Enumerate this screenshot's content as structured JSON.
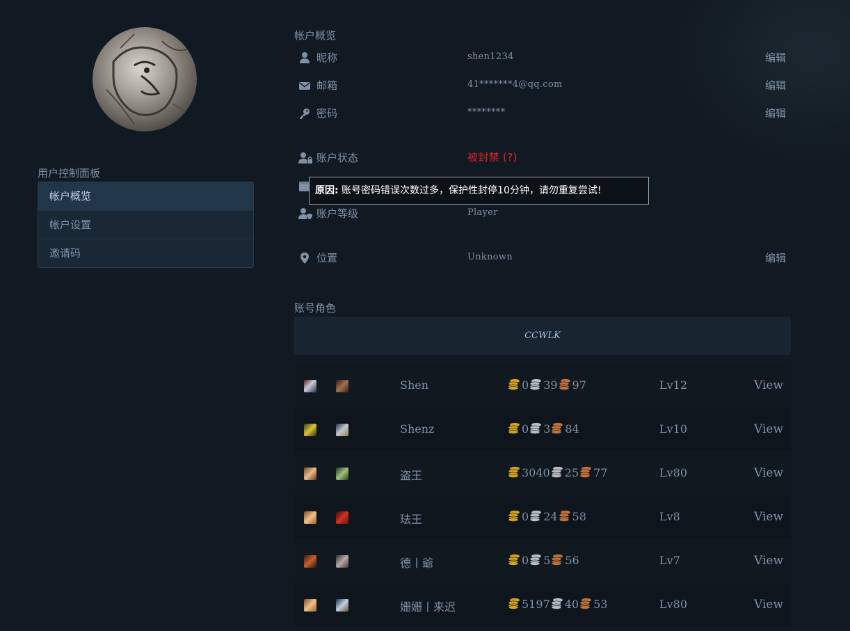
{
  "sidebar": {
    "title": "用户控制面板",
    "items": [
      {
        "label": "帐户概览"
      },
      {
        "label": "帐户设置"
      },
      {
        "label": "邀请码"
      }
    ]
  },
  "overview": {
    "title": "帐户概览",
    "nickname": {
      "label": "昵称",
      "value": "shen1234",
      "edit": "编辑",
      "icon": "user-icon"
    },
    "email": {
      "label": "邮箱",
      "value": "41*******4@qq.com",
      "edit": "编辑",
      "icon": "envelope-icon"
    },
    "password": {
      "label": "密码",
      "value": "********",
      "edit": "编辑",
      "icon": "key-icon"
    },
    "status": {
      "label": "账户状态",
      "value": "被封禁 (?)",
      "icon": "user-lock-icon",
      "color": "#e0202a"
    },
    "level": {
      "label": "账户等级",
      "value": "Player",
      "icon": "user-shield-icon"
    },
    "location": {
      "label": "位置",
      "value": "Unknown",
      "edit": "编辑",
      "icon": "map-marker-icon"
    }
  },
  "tooltip": {
    "prefix": "原因:",
    "text": " 账号密码错误次数过多，保护性封停10分钟，请勿重复尝试!"
  },
  "characters": {
    "title": "账号角色",
    "realm": "CCWLK",
    "view_label": "View",
    "rows": [
      {
        "name": "Shen",
        "gold": "0",
        "silver": "39",
        "copper": "97",
        "level": "Lv12",
        "view": "View"
      },
      {
        "name": "Shenz",
        "gold": "0",
        "silver": "3",
        "copper": "84",
        "level": "Lv10",
        "view": "View"
      },
      {
        "name": "盗王",
        "gold": "3040",
        "silver": "25",
        "copper": "77",
        "level": "Lv80",
        "view": "View"
      },
      {
        "name": "珐王",
        "gold": "0",
        "silver": "24",
        "copper": "58",
        "level": "Lv8",
        "view": "View"
      },
      {
        "name": "德丨爺",
        "gold": "0",
        "silver": "5",
        "copper": "56",
        "level": "Lv7",
        "view": "View"
      },
      {
        "name": "姗姗丨来迟",
        "gold": "5197",
        "silver": "40",
        "copper": "53",
        "level": "Lv80",
        "view": "View"
      }
    ]
  },
  "colors": {
    "gold": "#d4a21c",
    "silver": "#b9bfc5",
    "copper": "#c0723a"
  }
}
